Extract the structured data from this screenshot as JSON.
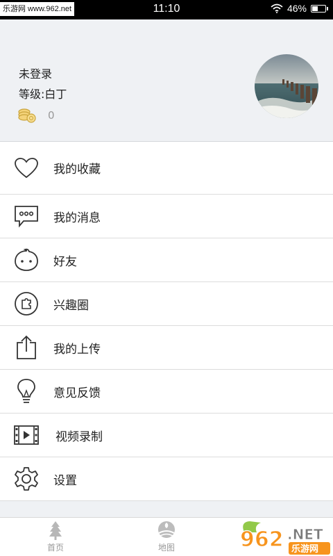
{
  "status_bar": {
    "watermark": "乐游网 www.962.net",
    "time": "11:10",
    "battery_percent": "46%"
  },
  "profile": {
    "username": "未登录",
    "level": "等级:白丁",
    "coins": "0"
  },
  "menu": [
    {
      "label": "我的收藏",
      "icon": "heart-icon"
    },
    {
      "label": "我的消息",
      "icon": "message-icon"
    },
    {
      "label": "好友",
      "icon": "friend-face-icon"
    },
    {
      "label": "兴趣圈",
      "icon": "puzzle-icon"
    },
    {
      "label": "我的上传",
      "icon": "upload-icon"
    },
    {
      "label": "意见反馈",
      "icon": "lightbulb-icon"
    },
    {
      "label": "视频录制",
      "icon": "film-icon"
    },
    {
      "label": "设置",
      "icon": "gear-icon"
    }
  ],
  "bottom_nav": {
    "tabs": [
      {
        "label": "首页",
        "icon": "tree-icon"
      },
      {
        "label": "地图",
        "icon": "globe-icon"
      }
    ]
  },
  "logo_text": {
    "number": "962",
    "suffix": ".NET",
    "brand": "乐游网"
  }
}
